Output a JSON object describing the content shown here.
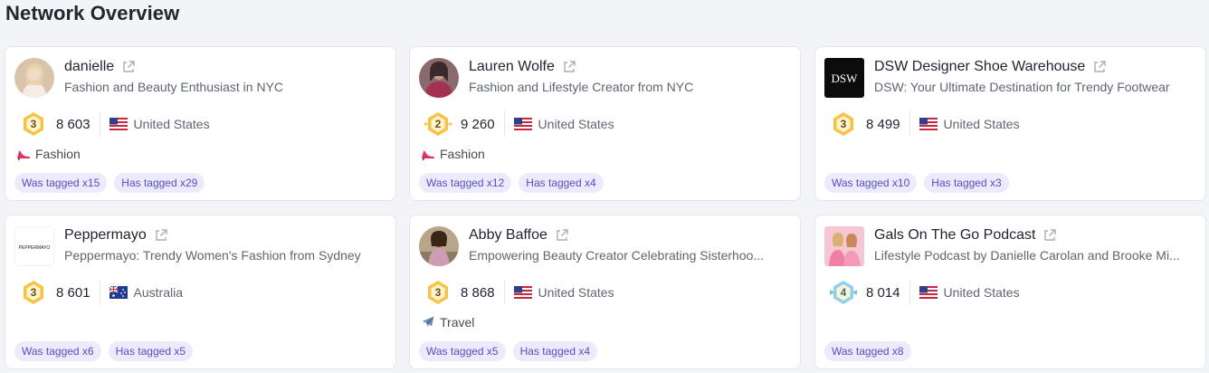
{
  "page": {
    "title": "Network Overview"
  },
  "colors": {
    "accent_tag_bg": "#ecebfb",
    "accent_tag_text": "#5a4cc7",
    "level_gold": "#f6c445"
  },
  "cards": [
    {
      "name": "danielle",
      "bio": "Fashion and Beauty Enthusiast in NYC",
      "level": "3",
      "followers": "8 603",
      "country": "United States",
      "flag": "us-flag-icon",
      "category": "Fashion",
      "category_icon": "high-heel-icon",
      "tags": {
        "was_tagged": "Was tagged x15",
        "has_tagged": "Has tagged x29"
      }
    },
    {
      "name": "Lauren Wolfe",
      "bio": "Fashion and Lifestyle Creator from NYC",
      "level": "2",
      "followers": "9 260",
      "country": "United States",
      "flag": "us-flag-icon",
      "category": "Fashion",
      "category_icon": "high-heel-icon",
      "tags": {
        "was_tagged": "Was tagged x12",
        "has_tagged": "Has tagged x4"
      }
    },
    {
      "name": "DSW Designer Shoe Warehouse",
      "bio": "DSW: Your Ultimate Destination for Trendy Footwear",
      "avatar_text": "DSW",
      "level": "3",
      "followers": "8 499",
      "country": "United States",
      "flag": "us-flag-icon",
      "tags": {
        "was_tagged": "Was tagged x10",
        "has_tagged": "Has tagged x3"
      }
    },
    {
      "name": "Peppermayo",
      "bio": "Peppermayo: Trendy Women's Fashion from Sydney",
      "avatar_text": "PEPPERMAYO",
      "level": "3",
      "followers": "8 601",
      "country": "Australia",
      "flag": "au-flag-icon",
      "tags": {
        "was_tagged": "Was tagged x6",
        "has_tagged": "Has tagged x5"
      }
    },
    {
      "name": "Abby Baffoe",
      "bio": "Empowering Beauty Creator Celebrating Sisterhoo...",
      "level": "3",
      "followers": "8 868",
      "country": "United States",
      "flag": "us-flag-icon",
      "category": "Travel",
      "category_icon": "airplane-icon",
      "tags": {
        "was_tagged": "Was tagged x5",
        "has_tagged": "Has tagged x4"
      }
    },
    {
      "name": "Gals On The Go Podcast",
      "bio": "Lifestyle Podcast by Danielle Carolan and Brooke Mi...",
      "level": "4",
      "followers": "8 014",
      "country": "United States",
      "flag": "us-flag-icon",
      "tags": {
        "was_tagged": "Was tagged x8"
      }
    }
  ]
}
